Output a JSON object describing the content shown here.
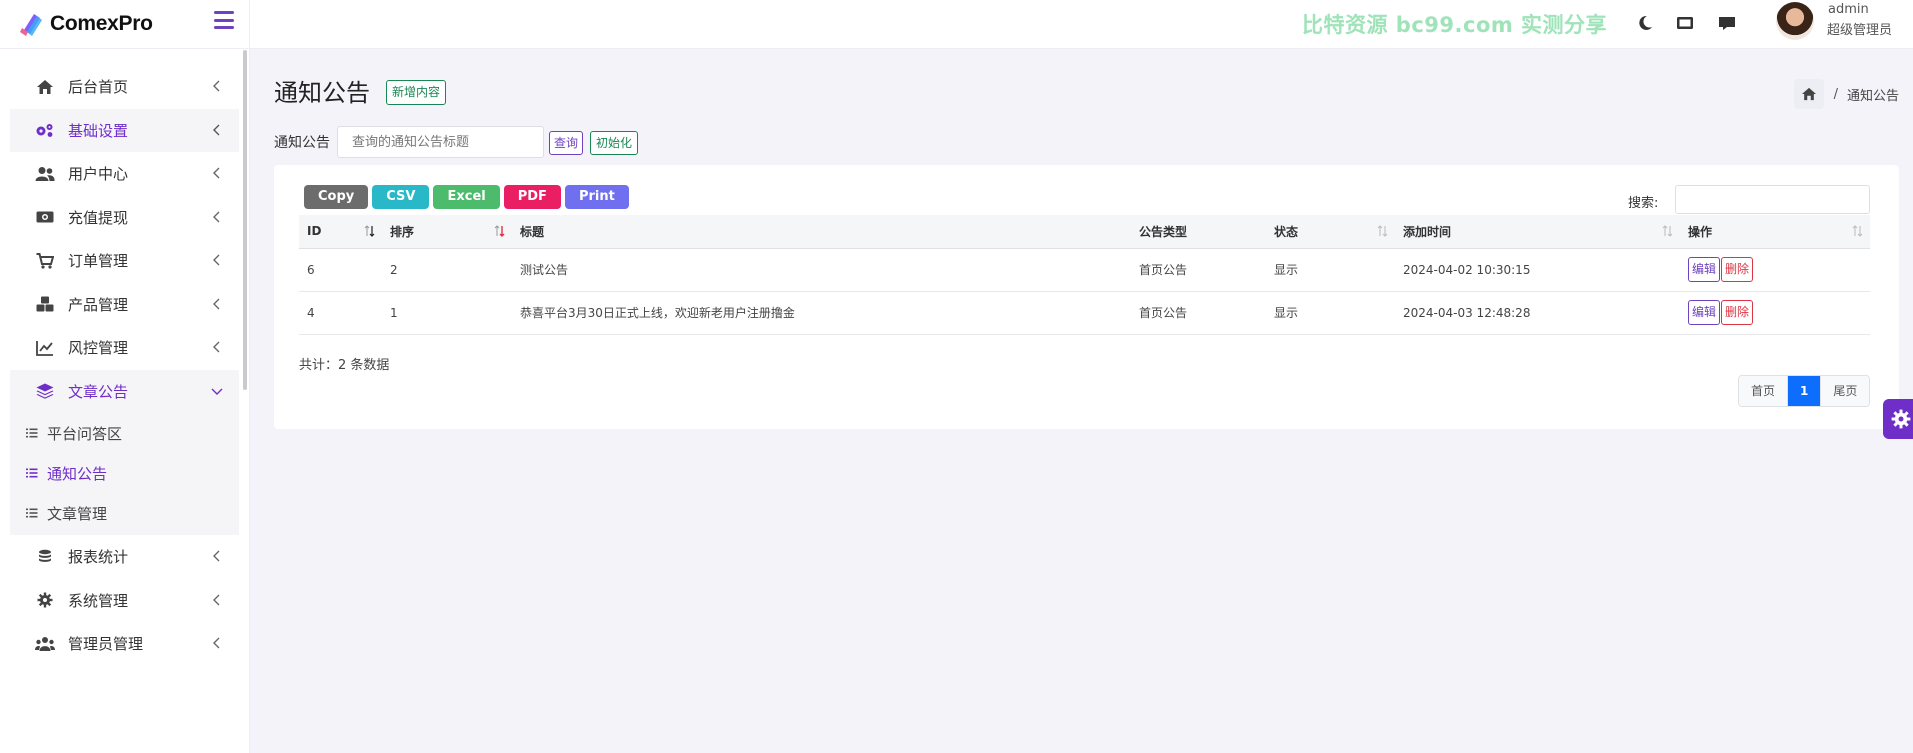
{
  "brand": {
    "name": "ComexPro"
  },
  "sidebar": {
    "items": [
      {
        "label": "后台首页",
        "icon": "home-icon"
      },
      {
        "label": "基础设置",
        "icon": "cogs-icon"
      },
      {
        "label": "用户中心",
        "icon": "users-icon"
      },
      {
        "label": "充值提现",
        "icon": "money-icon"
      },
      {
        "label": "订单管理",
        "icon": "cart-icon"
      },
      {
        "label": "产品管理",
        "icon": "cubes-icon"
      },
      {
        "label": "风控管理",
        "icon": "chart-line-icon"
      },
      {
        "label": "文章公告",
        "icon": "layers-icon"
      },
      {
        "label": "报表统计",
        "icon": "coins-icon"
      },
      {
        "label": "系统管理",
        "icon": "gear-icon"
      },
      {
        "label": "管理员管理",
        "icon": "user-group-icon"
      }
    ],
    "submenu": [
      {
        "label": "平台问答区"
      },
      {
        "label": "通知公告"
      },
      {
        "label": "文章管理"
      }
    ],
    "accent": "#6f2ec8"
  },
  "topbar": {
    "watermark": "比特资源 bc99.com 实测分享",
    "user_name": "admin",
    "user_role": "超级管理员"
  },
  "page": {
    "title": "通知公告",
    "add_label": "新增内容",
    "breadcrumb_current": "通知公告",
    "breadcrumb_sep": "/"
  },
  "filter": {
    "label": "通知公告",
    "placeholder": "查询的通知公告标题",
    "query_label": "查询",
    "reset_label": "初始化"
  },
  "export": {
    "buttons": [
      {
        "label": "Copy",
        "color": "#6c6c6c"
      },
      {
        "label": "CSV",
        "color": "#28b8c8"
      },
      {
        "label": "Excel",
        "color": "#4cbb6c"
      },
      {
        "label": "PDF",
        "color": "#e91e63"
      },
      {
        "label": "Print",
        "color": "#6f6ff0"
      }
    ],
    "search_label": "搜索:"
  },
  "table": {
    "headers": [
      "ID",
      "排序",
      "标题",
      "公告类型",
      "状态",
      "添加时间",
      "操作"
    ],
    "rows": [
      {
        "id": "6",
        "order": "2",
        "title": "测试公告",
        "type": "首页公告",
        "status": "显示",
        "time": "2024-04-02 10:30:15"
      },
      {
        "id": "4",
        "order": "1",
        "title": "恭喜平台3月30日正式上线，欢迎新老用户注册撸金",
        "type": "首页公告",
        "status": "显示",
        "time": "2024-04-03 12:48:28"
      }
    ],
    "edit_label": "编辑",
    "delete_label": "删除",
    "total": "共计：2 条数据"
  },
  "pagination": {
    "first": "首页",
    "current": "1",
    "last": "尾页"
  }
}
